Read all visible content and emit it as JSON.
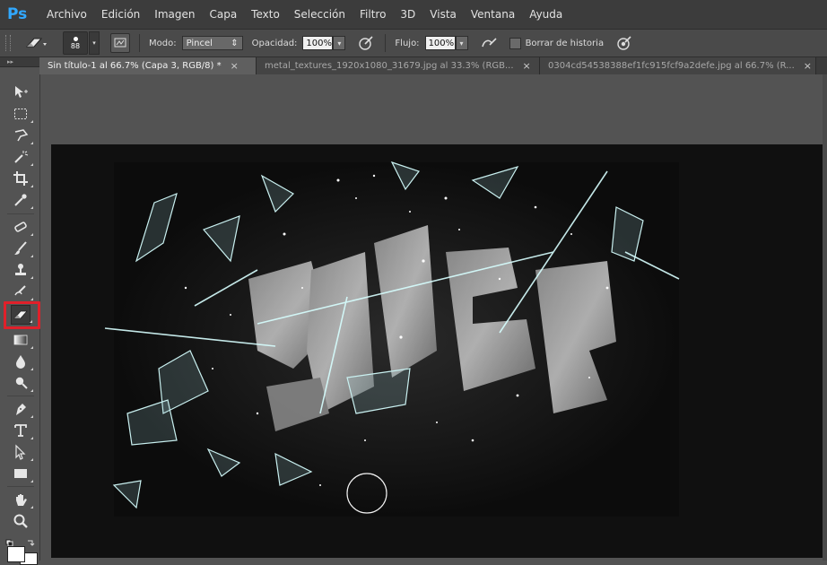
{
  "app": {
    "logo": "Ps",
    "accent": "#31a8ff"
  },
  "menu": [
    "Archivo",
    "Edición",
    "Imagen",
    "Capa",
    "Texto",
    "Selección",
    "Filtro",
    "3D",
    "Vista",
    "Ventana",
    "Ayuda"
  ],
  "options": {
    "tool_icon": "eraser-icon",
    "brush_size": "88",
    "mode_label": "Modo:",
    "mode_value": "Pincel",
    "opacity_label": "Opacidad:",
    "opacity_value": "100%",
    "flow_label": "Flujo:",
    "flow_value": "100%",
    "erase_history_label": "Borrar de historia",
    "erase_history_checked": false
  },
  "tabs": [
    {
      "label": "Sin título-1 al 66.7% (Capa 3, RGB/8) *",
      "active": true
    },
    {
      "label": "metal_textures_1920x1080_31679.jpg al 33.3% (RGB...",
      "active": false
    },
    {
      "label": "0304cd54538388ef1fc915fcf9a2defe.jpg al 66.7% (R...",
      "active": false
    }
  ],
  "tools": [
    "move-tool",
    "marquee-tool",
    "lasso-tool",
    "magic-wand-tool",
    "crop-tool",
    "eyedropper-tool",
    "healing-brush-tool",
    "brush-tool",
    "clone-stamp-tool",
    "history-brush-tool",
    "eraser-tool",
    "gradient-tool",
    "blur-tool",
    "dodge-tool",
    "pen-tool",
    "type-tool",
    "path-selection-tool",
    "rectangle-tool",
    "hand-tool",
    "zoom-tool"
  ],
  "selected_tool": "eraser-tool",
  "highlight_color": "#e0202a",
  "colors": {
    "foreground": "#ffffff",
    "background": "#ffffff"
  }
}
